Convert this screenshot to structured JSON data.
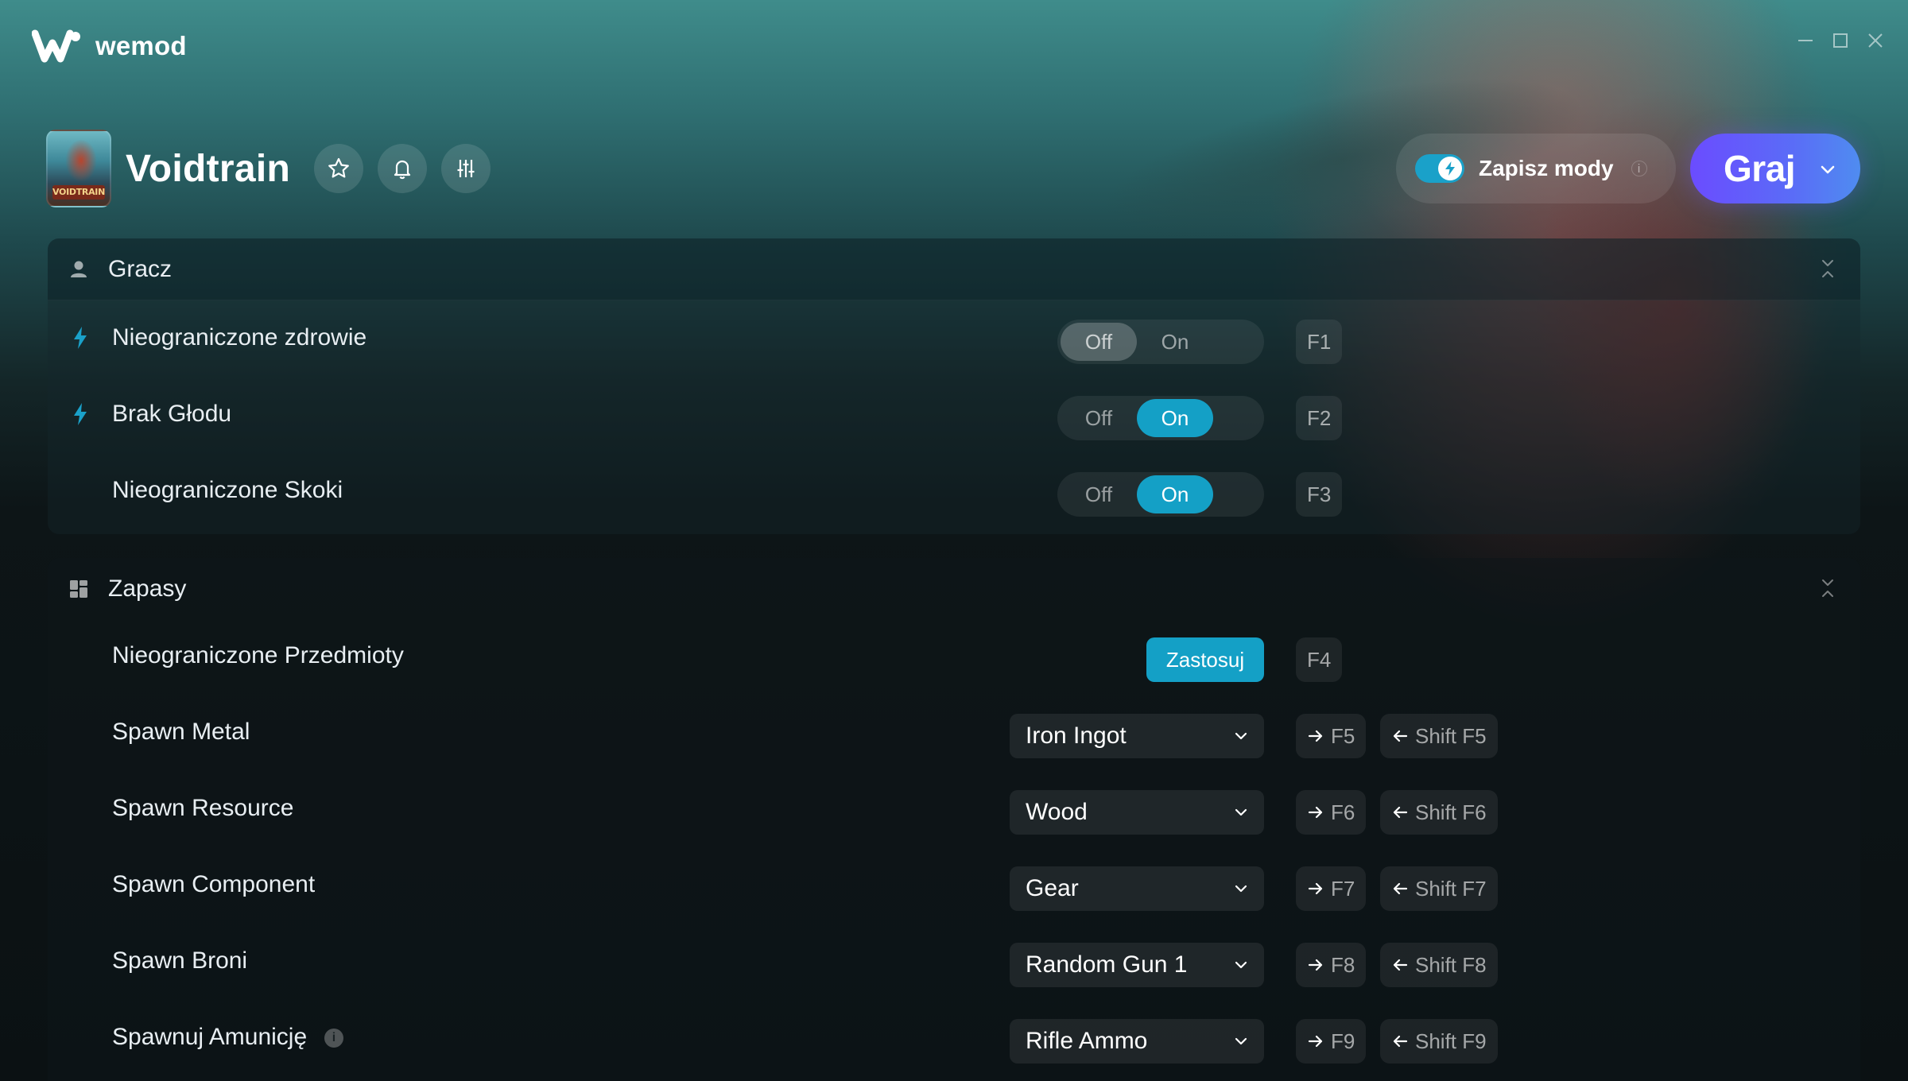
{
  "app": {
    "name": "wemod"
  },
  "game": {
    "title": "Voidtrain",
    "thumb_label": "VOIDTRAIN"
  },
  "header": {
    "save_mods_label": "Zapisz mody",
    "save_mods_info": "i",
    "play_label": "Graj"
  },
  "icons": {
    "brand": "wemod-logo-icon",
    "favorite": "star-icon",
    "notify": "bell-icon",
    "settings": "sliders-icon",
    "player_section": "user-icon",
    "supplies_section": "grid-icon",
    "mod_marker": "bolt-icon"
  },
  "colors": {
    "accent": "#14a0c6",
    "play_gradient_start": "#6b4cff",
    "play_gradient_end": "#4f8cf0"
  },
  "toggle_labels": {
    "off": "Off",
    "on": "On"
  },
  "sections": {
    "player": {
      "title": "Gracz",
      "mods": [
        {
          "label": "Nieograniczone zdrowie",
          "state": "Off",
          "hotkey": "F1",
          "pro": true
        },
        {
          "label": "Brak Głodu",
          "state": "On",
          "hotkey": "F2",
          "pro": true
        },
        {
          "label": "Nieograniczone Skoki",
          "state": "On",
          "hotkey": "F3",
          "pro": false
        }
      ]
    },
    "supplies": {
      "title": "Zapasy",
      "apply": {
        "label": "Nieograniczone Przedmioty",
        "button": "Zastosuj",
        "hotkey": "F4"
      },
      "spawns": [
        {
          "label": "Spawn Metal",
          "value": "Iron Ingot",
          "next_key": "F5",
          "prev_key": "Shift F5"
        },
        {
          "label": "Spawn Resource",
          "value": "Wood",
          "next_key": "F6",
          "prev_key": "Shift F6"
        },
        {
          "label": "Spawn Component",
          "value": "Gear",
          "next_key": "F7",
          "prev_key": "Shift F7"
        },
        {
          "label": "Spawn Broni",
          "value": "Random Gun 1",
          "next_key": "F8",
          "prev_key": "Shift F8"
        },
        {
          "label": "Spawnuj Amunicję",
          "value": "Rifle Ammo",
          "next_key": "F9",
          "prev_key": "Shift F9",
          "info": "i"
        }
      ]
    }
  }
}
